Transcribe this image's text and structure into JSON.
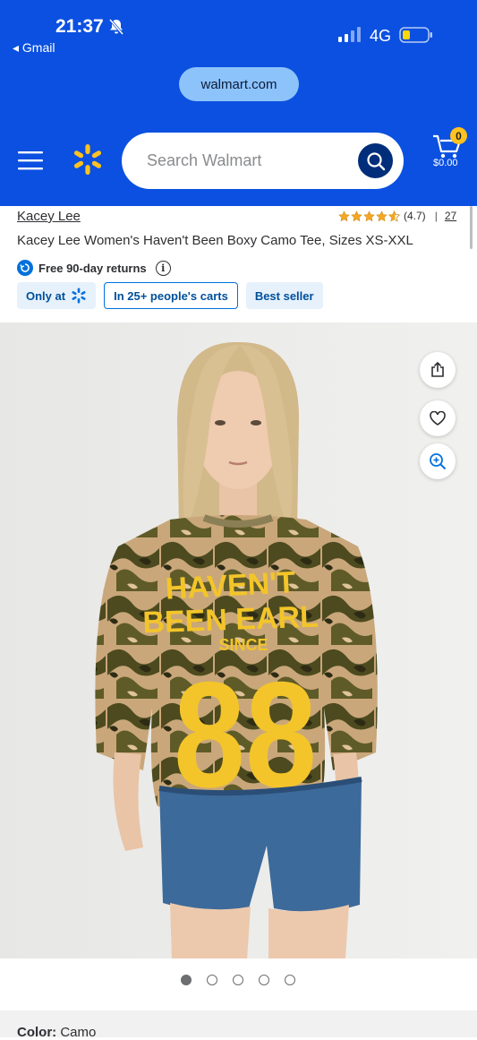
{
  "status_bar": {
    "time": "21:37",
    "back_label": "◂ Gmail",
    "network": "4G"
  },
  "browser": {
    "url": "walmart.com"
  },
  "header": {
    "search_placeholder": "Search Walmart",
    "cart_count": "0",
    "cart_total": "$0.00"
  },
  "product": {
    "brand": "Kacey Lee",
    "rating": "(4.7)",
    "separator": "|",
    "review_count": "27",
    "title": "Kacey Lee Women's Haven't Been Boxy Camo Tee, Sizes XS-XXL",
    "returns": "Free 90-day returns",
    "badges": {
      "only_at": "Only at",
      "carts": "In 25+ people's carts",
      "best_seller": "Best seller"
    },
    "image_count": 5,
    "active_image": 1,
    "shirt_text": {
      "line1": "HAVEN'T",
      "line2": "BEEN EARL",
      "line3": "SINCE",
      "number": "88"
    },
    "color_label": "Color:",
    "color_value": "Camo"
  },
  "colors": {
    "walmart_blue": "#0b50e0",
    "spark_yellow": "#ffc220",
    "link_blue": "#0071dc"
  }
}
